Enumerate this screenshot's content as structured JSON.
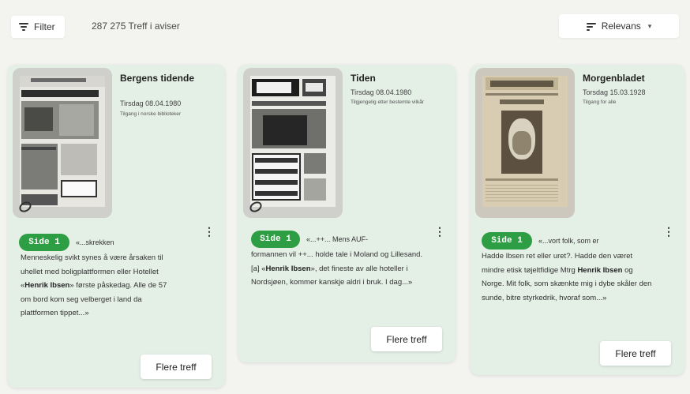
{
  "toolbar": {
    "filter_label": "Filter",
    "hit_count": "287 275 Treff i aviser",
    "sort_label": "Relevans",
    "sort_caret": "▾"
  },
  "results": [
    {
      "newspaper": "Bergens tidende",
      "date": "Tirsdag 08.04.1980",
      "access": "Tilgang i norske biblioteker",
      "page_badge": "Side 1",
      "lead": "«...skrekken",
      "snippet_before": "Menneskelig svikt synes å være årsaken til uhellet med boligplattformen eller Hotellet «",
      "snippet_bold": "Henrik Ibsen",
      "snippet_after": "» første påskedag. Alle de 57 om bord kom seg velberget i land da plattformen tippet...»",
      "more_label": "Flere treff",
      "menu_glyph": "⋮"
    },
    {
      "newspaper": "Tiden",
      "date": "Tirsdag 08.04.1980",
      "access": "Tilgjengelig etter bestemte vilkår",
      "page_badge": "Side 1",
      "lead": "«...++... Mens AUF-",
      "snippet_before": "formannen vil ++... holde tale i Moland og Lillesand. [a] «",
      "snippet_bold": "Henrik Ibsen",
      "snippet_after": "», det fineste av alle hoteller i Nordsjøen, kommer kanskje aldri i bruk. I dag...»",
      "more_label": "Flere treff",
      "menu_glyph": "⋮"
    },
    {
      "newspaper": "Morgenbladet",
      "date": "Torsdag 15.03.1928",
      "access": "Tilgang for alle",
      "page_badge": "Side 1",
      "lead": "«...vort folk, som er",
      "snippet_before": "Hadde Ibsen ret eller uret?. Hadde den været mindre etisk tøjeltfidige Mtrg ",
      "snippet_bold": "Henrik Ibsen",
      "snippet_after": " og Norge. Mit folk, som skænkte mig i dybe skåler den sunde, bitre styrkedrik, hvoraf som...»",
      "more_label": "Flere treff",
      "menu_glyph": "⋮"
    }
  ]
}
